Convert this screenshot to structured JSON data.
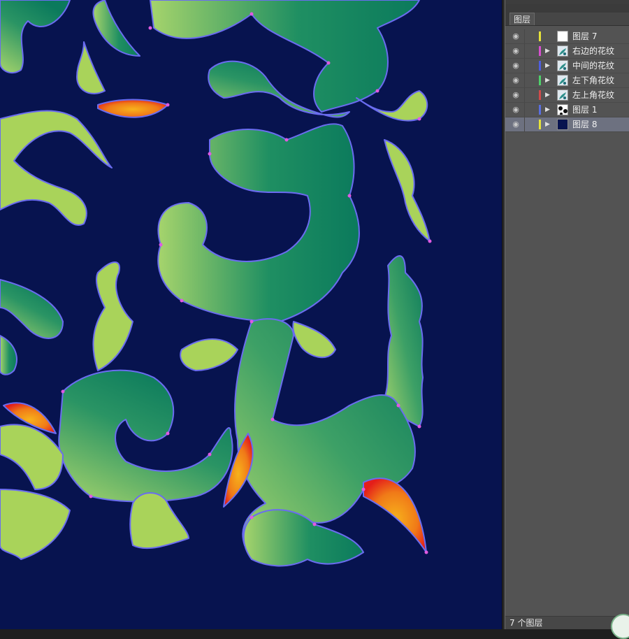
{
  "panel": {
    "tab_label": "图层",
    "layers": [
      {
        "name": "图层 7",
        "color": "#e6e23a",
        "thumb": "white",
        "expandable": false,
        "selected": false
      },
      {
        "name": "右边的花纹",
        "color": "#d74fd0",
        "thumb": "pattern",
        "expandable": true,
        "selected": false
      },
      {
        "name": "中间的花纹",
        "color": "#4f5fe0",
        "thumb": "pattern",
        "expandable": true,
        "selected": false
      },
      {
        "name": "左下角花纹",
        "color": "#4fd06a",
        "thumb": "pattern",
        "expandable": true,
        "selected": false
      },
      {
        "name": "左上角花纹",
        "color": "#d04a4a",
        "thumb": "pattern",
        "expandable": true,
        "selected": false
      },
      {
        "name": "图层 1",
        "color": "#5a6fe0",
        "thumb": "dots",
        "expandable": true,
        "selected": false
      },
      {
        "name": "图层 8",
        "color": "#e6e23a",
        "thumb": "navy",
        "expandable": true,
        "selected": true
      }
    ],
    "footer": {
      "layer_count": "7 个图层"
    }
  },
  "icons": {
    "eye": "eye-icon",
    "expand": "expand-triangle-icon"
  },
  "colors": {
    "canvas_bg": "#07134f",
    "leaf_dark": "#0b7a5c",
    "leaf_light": "#a6d46c",
    "stem": "#a9d35a",
    "petal_red": "#e8201a",
    "petal_orange": "#f5a21a",
    "path_outline": "#6a6cf0",
    "anchor": "#e05ae0"
  }
}
